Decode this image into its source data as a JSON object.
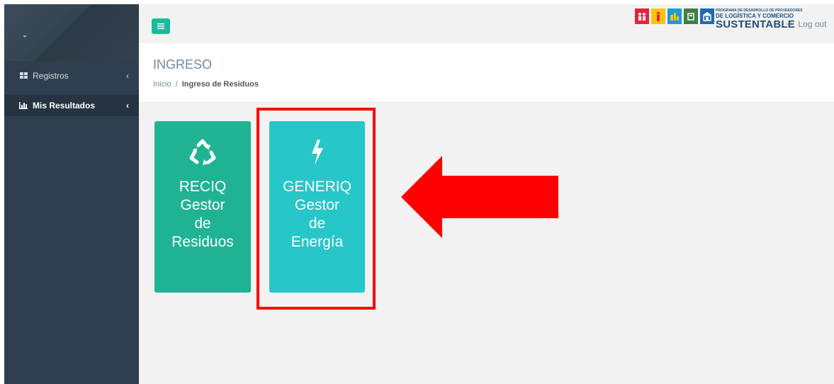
{
  "header": {
    "logout_label": "Log out",
    "logo": {
      "line1": "PROGRAMA DE DESARROLLO DE PROVEEDORES",
      "line2": "DE LOGÍSTICA Y COMERCIO",
      "line3": "SUSTENTABLE"
    }
  },
  "sidebar": {
    "items": [
      {
        "label": "Registros",
        "icon": "grid-icon"
      },
      {
        "label": "Mis Resultados",
        "icon": "bar-chart-icon"
      }
    ]
  },
  "page": {
    "title": "INGRESO",
    "breadcrumb": {
      "home": "Inicio",
      "separator": "/",
      "current": "Ingreso de Residuos"
    }
  },
  "tiles": [
    {
      "lines": [
        "RECIQ",
        "Gestor",
        "de",
        "Residuos"
      ],
      "icon": "recycle-icon",
      "color": "#1fb394"
    },
    {
      "lines": [
        "GENERIQ",
        "Gestor",
        "de",
        "Energía"
      ],
      "icon": "bolt-icon",
      "color": "#26c6c9"
    }
  ],
  "colors": {
    "sidebar": "#2f3f4f",
    "accent": "#1abb9c",
    "highlight": "#ff0000"
  }
}
